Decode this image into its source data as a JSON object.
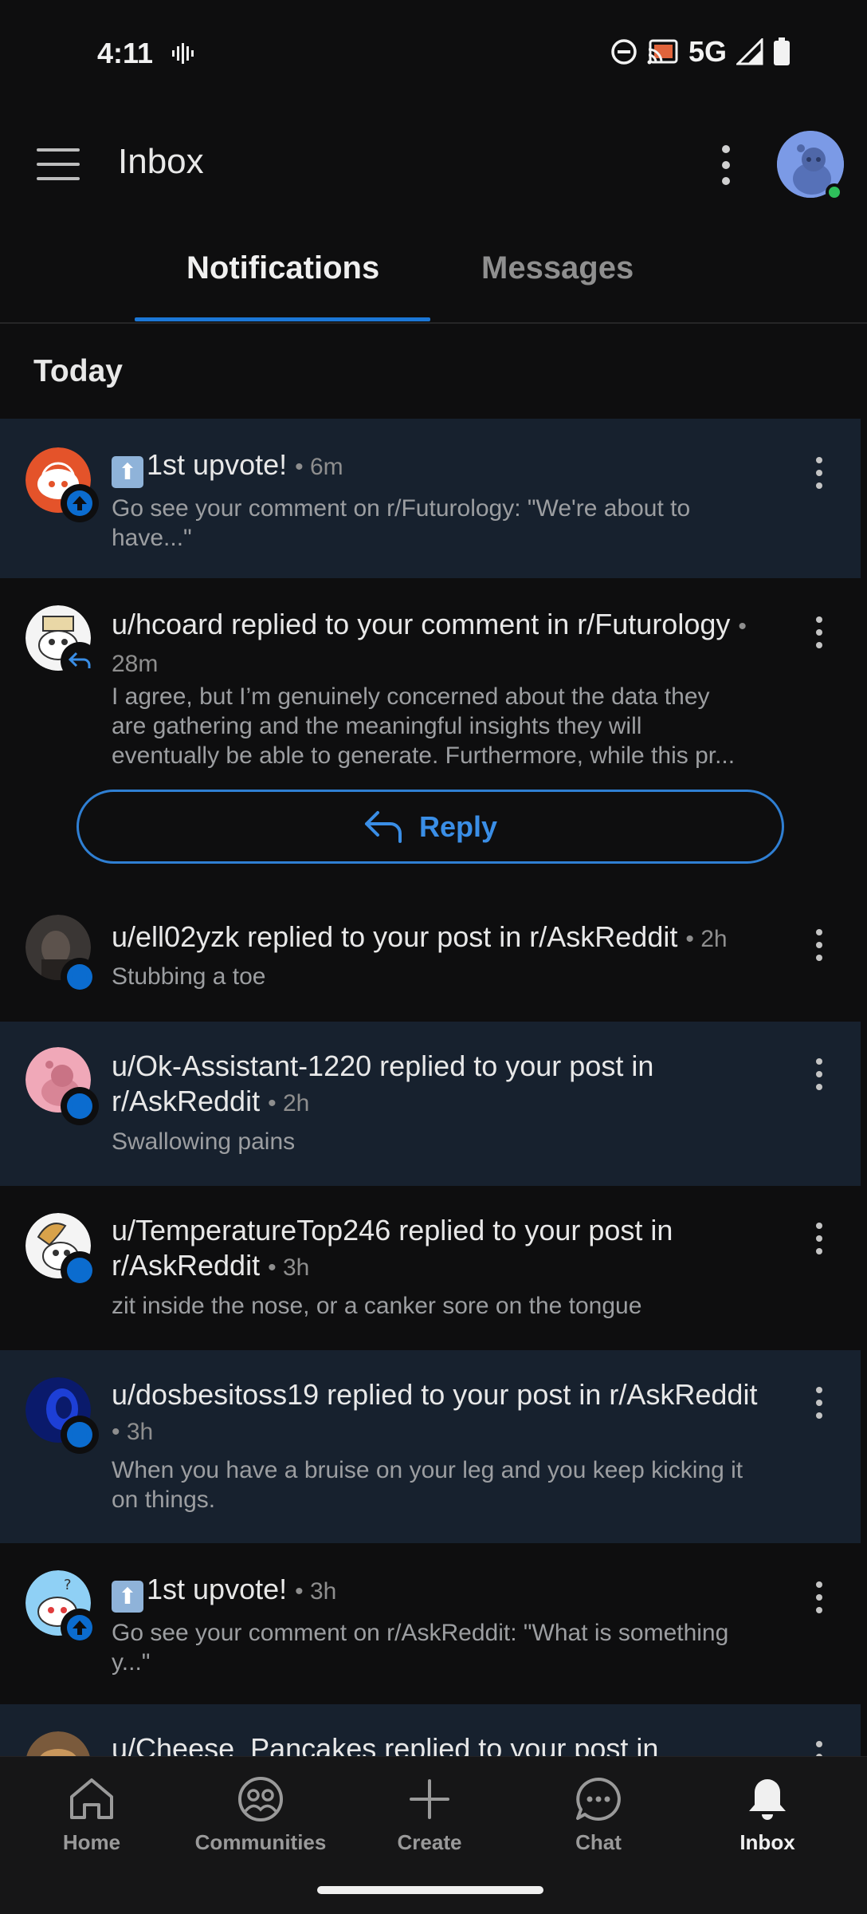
{
  "status_bar": {
    "time": "4:11",
    "network": "5G"
  },
  "header": {
    "title": "Inbox"
  },
  "tabs": [
    {
      "label": "Notifications",
      "active": true
    },
    {
      "label": "Messages",
      "active": false
    }
  ],
  "section_label": "Today",
  "notifications": [
    {
      "title_prefix": "1st upvote!",
      "time": "6m",
      "body": "Go see your comment on r/Futurology: \"We're about to have...\"",
      "unread": true
    },
    {
      "title": "u/hcoard replied to your comment in r/Futurology",
      "time": "28m",
      "body": "I agree, but I’m genuinely concerned about the data they are gathering and the meaningful insights they will eventually be able to generate. Furthermore, while this pr...",
      "unread": false,
      "reply_label": "Reply"
    },
    {
      "title": "u/ell02yzk replied to your post in r/AskReddit",
      "time": "2h",
      "body": "Stubbing a toe",
      "unread": false
    },
    {
      "title": "u/Ok-Assistant-1220 replied to your post in r/AskReddit",
      "time": "2h",
      "body": "Swallowing pains",
      "unread": true
    },
    {
      "title": "u/TemperatureTop246 replied to your post in r/AskReddit",
      "time": "3h",
      "body": "zit inside the nose, or a canker sore on the tongue",
      "unread": false
    },
    {
      "title": "u/dosbesitoss19 replied to your post in r/AskReddit",
      "time": "3h",
      "body": "When you have a bruise on your leg and you keep kicking it on things.",
      "unread": true
    },
    {
      "title_prefix": "1st upvote!",
      "time": "3h",
      "body": "Go see your comment on r/AskReddit: \"What is something y...\"",
      "unread": false
    },
    {
      "title": "u/Cheese_Pancakes replied to your post in",
      "unread": true
    }
  ],
  "bottom_nav": [
    {
      "label": "Home",
      "icon": "home-icon"
    },
    {
      "label": "Communities",
      "icon": "communities-icon"
    },
    {
      "label": "Create",
      "icon": "plus-icon"
    },
    {
      "label": "Chat",
      "icon": "chat-icon"
    },
    {
      "label": "Inbox",
      "icon": "bell-icon",
      "active": true
    }
  ],
  "colors": {
    "accent": "#1b77d6",
    "unread_bg": "#17212e",
    "background": "#0e0e0f",
    "online": "#2ec05b"
  }
}
